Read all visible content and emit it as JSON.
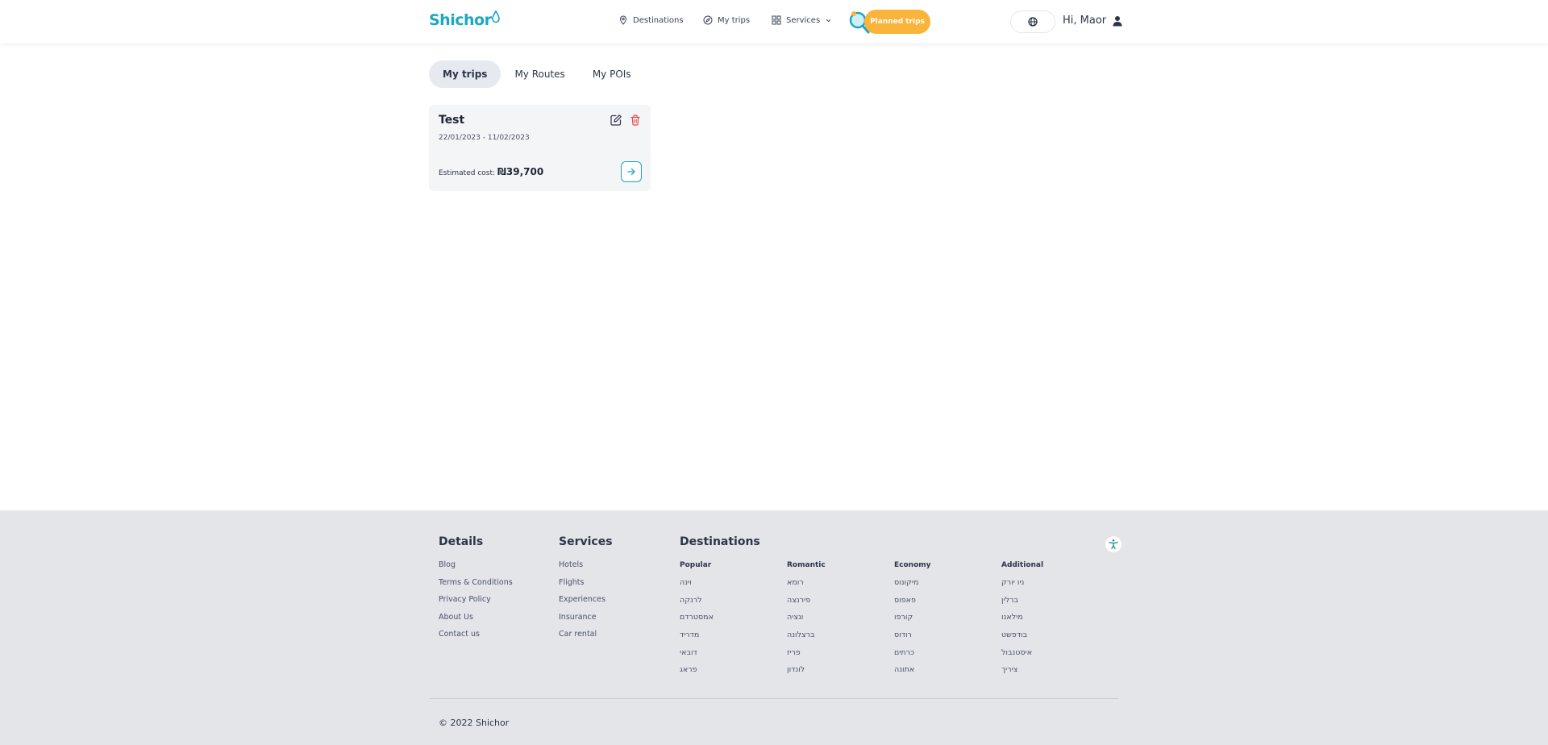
{
  "header": {
    "logo_text": "Shichor",
    "nav": [
      {
        "label": "Destinations",
        "icon": "location-pin-icon"
      },
      {
        "label": "My trips",
        "icon": "compass-icon"
      },
      {
        "label": "Services",
        "icon": "grid-icon"
      }
    ],
    "planned_trips_label": "Planned trips",
    "greeting": "Hi, Maor"
  },
  "tabs": [
    {
      "label": "My trips",
      "active": true
    },
    {
      "label": "My Routes",
      "active": false
    },
    {
      "label": "My POIs",
      "active": false
    }
  ],
  "trip": {
    "title": "Test",
    "dates": "22/01/2023 - 11/02/2023",
    "cost_label": "Estimated cost:",
    "cost_value": "₪39,700"
  },
  "footer": {
    "details": {
      "heading": "Details",
      "links": [
        "Blog",
        "Terms & Conditions",
        "Privacy Policy",
        "About Us",
        "Contact us"
      ]
    },
    "services": {
      "heading": "Services",
      "links": [
        "Hotels",
        "Flights",
        "Experiences",
        "Insurance",
        "Car rental"
      ]
    },
    "destinations": {
      "heading": "Destinations",
      "columns": [
        {
          "title": "Popular",
          "items": [
            "וינה",
            "לרנקה",
            "אמסטרדם",
            "מדריד",
            "דובאי",
            "פראג"
          ]
        },
        {
          "title": "Romantic",
          "items": [
            "רומא",
            "פירנצה",
            "ונציה",
            "ברצלונה",
            "פריז",
            "לונדון"
          ]
        },
        {
          "title": "Economy",
          "items": [
            "מיקונוס",
            "פאפוס",
            "קורפו",
            "רודוס",
            "כרתים",
            "אתונה"
          ]
        },
        {
          "title": "Additional",
          "items": [
            "ניו יורק",
            "ברלין",
            "מילאנו",
            "בודפשט",
            "איסטנבול",
            "ציריך"
          ]
        }
      ]
    },
    "copyright": "© 2022 Shichor"
  },
  "colors": {
    "brand": "#1ba7c4",
    "accent": "#fbb33a",
    "delete": "#e5484d",
    "footer_bg": "#e3e5e9"
  }
}
